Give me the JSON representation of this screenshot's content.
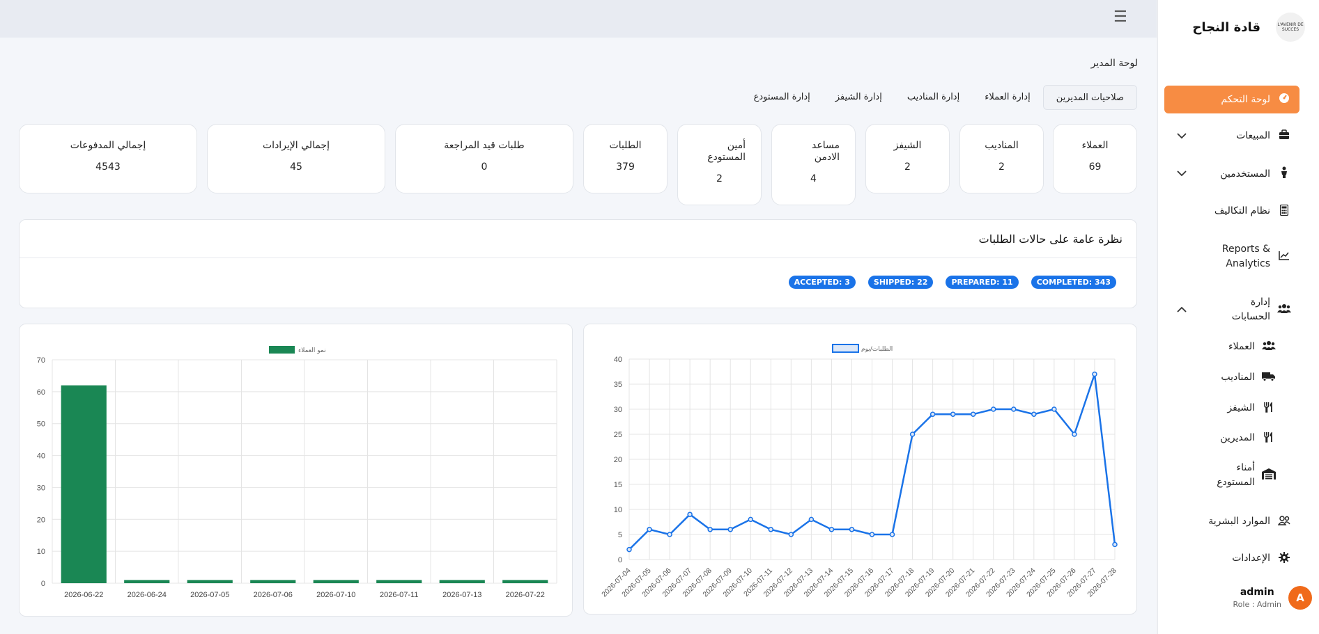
{
  "brand": {
    "logo_text": "L'AVENIR DE SUCCES",
    "title": "قادة النجاح"
  },
  "sidebar": {
    "items": [
      {
        "label": "لوحة التحكم",
        "icon": "dashboard-icon",
        "active": true
      },
      {
        "label": "المبيعات",
        "icon": "briefcase-icon",
        "expandable": true,
        "expanded": false
      },
      {
        "label": "المستخدمين",
        "icon": "person-icon",
        "expandable": true,
        "expanded": false
      },
      {
        "label": "نظام التكاليف",
        "icon": "calculator-icon"
      },
      {
        "label": "Reports & Analytics",
        "icon": "chart-line-icon"
      },
      {
        "label": "إدارة الحسابات",
        "icon": "users-icon",
        "expandable": true,
        "expanded": true
      },
      {
        "label": "العملاء",
        "icon": "users-icon",
        "sub": true
      },
      {
        "label": "المناديب",
        "icon": "truck-icon",
        "sub": true
      },
      {
        "label": "الشيفز",
        "icon": "utensils-icon",
        "sub": true
      },
      {
        "label": "المديرين",
        "icon": "utensils-icon",
        "sub": true
      },
      {
        "label": "أمناء المستودع",
        "icon": "warehouse-icon",
        "sub": true
      },
      {
        "label": "الموارد البشرية",
        "icon": "people-icon"
      },
      {
        "label": "الإعدادات",
        "icon": "gear-icon"
      }
    ]
  },
  "admin": {
    "avatar": "A",
    "name": "admin",
    "role": "Role : Admin"
  },
  "page": {
    "title": "لوحة المدير"
  },
  "tabs": [
    "صلاحيات المديرين",
    "إدارة العملاء",
    "إدارة المناديب",
    "إدارة الشيفز",
    "إدارة المستودع"
  ],
  "stats": [
    {
      "label": "العملاء",
      "value": "69"
    },
    {
      "label": "المناديب",
      "value": "2"
    },
    {
      "label": "الشيفز",
      "value": "2"
    },
    {
      "label": "مساعد الادمن",
      "value": "4"
    },
    {
      "label": "أمين المستودع",
      "value": "2"
    },
    {
      "label": "الطلبات",
      "value": "379"
    },
    {
      "label": "طلبات قيد المراجعة",
      "value": "0"
    },
    {
      "label": "إجمالي الإيرادات",
      "value": "45"
    },
    {
      "label": "إجمالي المدفوعات",
      "value": "4543"
    }
  ],
  "overview": {
    "title": "نظرة عامة على حالات الطلبات",
    "badges": [
      "COMPLETED: 343",
      "PREPARED: 11",
      "SHIPPED: 22",
      "ACCEPTED: 3"
    ]
  },
  "colors": {
    "accent": "#f78c43",
    "blue": "#1a73e8",
    "green": "#1a8754"
  },
  "chart_data": [
    {
      "type": "line",
      "legend": "الطلبات/يوم",
      "x": [
        "2026-07-04",
        "2026-07-05",
        "2026-07-06",
        "2026-07-07",
        "2026-07-08",
        "2026-07-09",
        "2026-07-10",
        "2026-07-11",
        "2026-07-12",
        "2026-07-13",
        "2026-07-14",
        "2026-07-15",
        "2026-07-16",
        "2026-07-17",
        "2026-07-18",
        "2026-07-19",
        "2026-07-20",
        "2026-07-21",
        "2026-07-22",
        "2026-07-23",
        "2026-07-24",
        "2026-07-25",
        "2026-07-26",
        "2026-07-27",
        "2026-07-28"
      ],
      "values": [
        2,
        6,
        5,
        9,
        6,
        6,
        8,
        6,
        5,
        8,
        6,
        6,
        5,
        5,
        25,
        29,
        29,
        29,
        30,
        30,
        29,
        30,
        25,
        37,
        3
      ],
      "ylim": [
        0,
        40
      ],
      "yticks": [
        0,
        5,
        10,
        15,
        20,
        25,
        30,
        35,
        40
      ],
      "grid": true
    },
    {
      "type": "bar",
      "legend": "نمو العملاء",
      "categories": [
        "2026-06-22",
        "2026-06-24",
        "2026-07-05",
        "2026-07-06",
        "2026-07-10",
        "2026-07-11",
        "2026-07-13",
        "2026-07-22"
      ],
      "values": [
        62,
        1,
        1,
        1,
        1,
        1,
        1,
        1
      ],
      "ylim": [
        0,
        70
      ],
      "yticks": [
        0,
        10,
        20,
        30,
        40,
        50,
        60,
        70
      ],
      "grid": true
    }
  ]
}
